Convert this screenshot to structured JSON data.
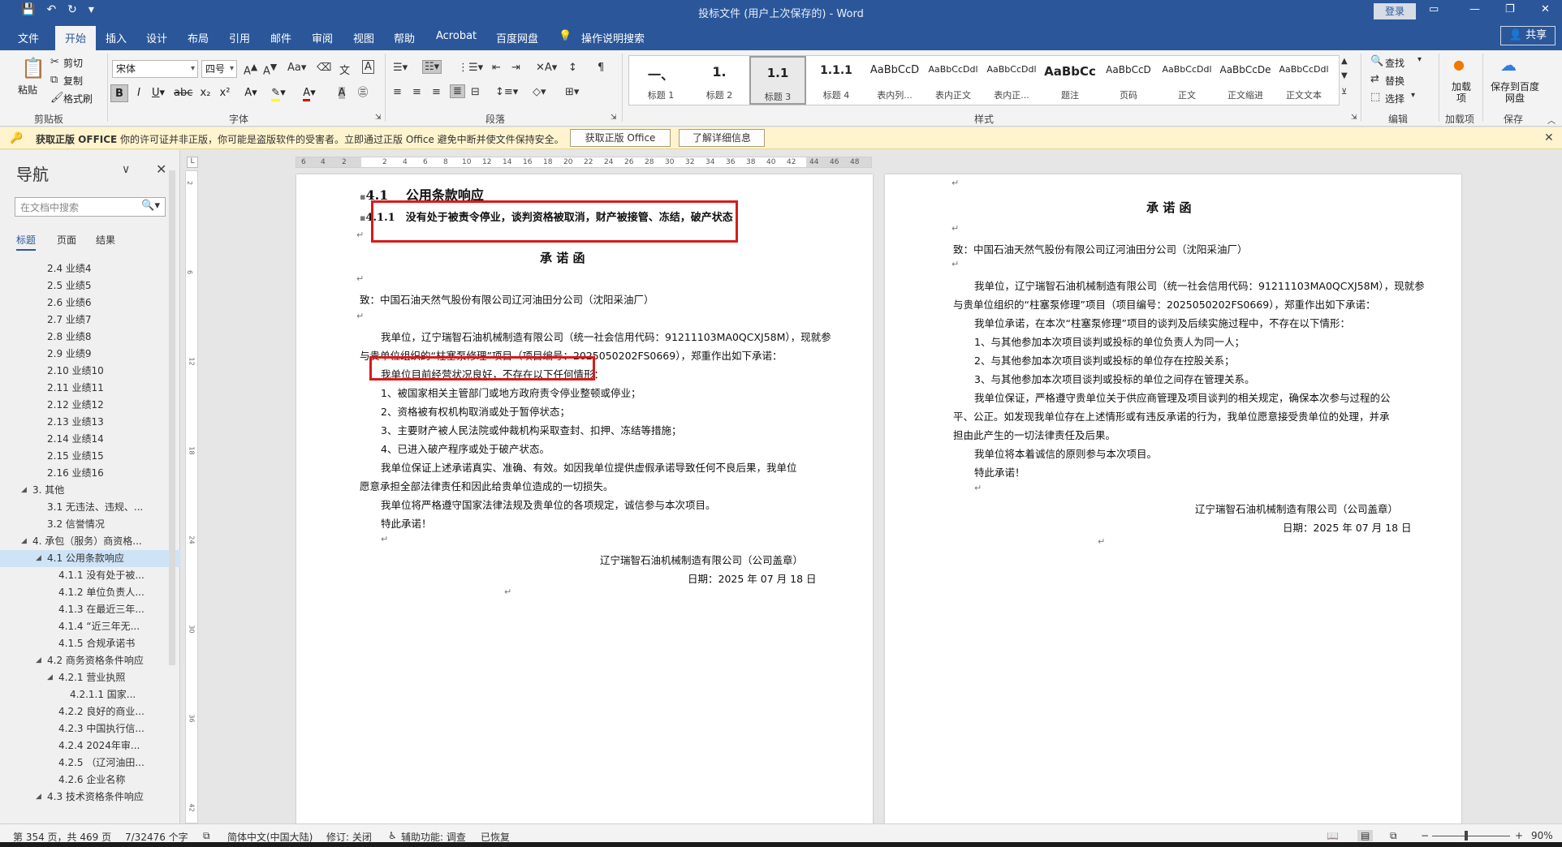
{
  "window": {
    "title": "投标文件 (用户上次保存的) - Word",
    "login_label": "登录",
    "qat": [
      "save-icon",
      "undo-icon",
      "redo-icon",
      "customize-icon"
    ]
  },
  "tabs": [
    "文件",
    "开始",
    "插入",
    "设计",
    "布局",
    "引用",
    "邮件",
    "审阅",
    "视图",
    "帮助",
    "Acrobat",
    "百度网盘",
    "操作说明搜索"
  ],
  "active_tab": "开始",
  "share_label": "共享",
  "ribbon": {
    "clipboard": {
      "paste": "粘贴",
      "cut": "剪切",
      "copy": "复制",
      "format_painter": "格式刷",
      "label": "剪贴板"
    },
    "font": {
      "font_name": "宋体",
      "font_size": "四号",
      "label": "字体"
    },
    "paragraph": {
      "label": "段落"
    },
    "styles": {
      "label": "样式",
      "items": [
        {
          "preview": "一、",
          "name": "标题 1"
        },
        {
          "preview": "1.",
          "name": "标题 2"
        },
        {
          "preview": "1.1",
          "name": "标题 3"
        },
        {
          "preview": "1.1.1",
          "name": "标题 4"
        },
        {
          "preview": "AaBbCcD",
          "name": "表内列..."
        },
        {
          "preview": "AaBbCcDdl",
          "name": "表内正文"
        },
        {
          "preview": "AaBbCcDdl",
          "name": "表内正..."
        },
        {
          "preview": "AaBbCc",
          "name": "题注"
        },
        {
          "preview": "AaBbCcD",
          "name": "页码"
        },
        {
          "preview": "AaBbCcDdl",
          "name": "正文"
        },
        {
          "preview": "AaBbCcDe",
          "name": "正文缩进"
        },
        {
          "preview": "AaBbCcDdl",
          "name": "正文文本"
        }
      ],
      "selected_index": 2
    },
    "editing": {
      "find": "查找",
      "replace": "替换",
      "select": "选择",
      "label": "编辑"
    },
    "addins": {
      "btn": "加载项",
      "label": "加载项"
    },
    "save": {
      "btn": "保存到百度网盘",
      "label": "保存"
    }
  },
  "infobar": {
    "title": "获取正版 OFFICE",
    "message": "你的许可证并非正版，你可能是盗版软件的受害者。立即通过正版 Office 避免中断并使文件保持安全。",
    "btn1": "获取正版 Office",
    "btn2": "了解详细信息"
  },
  "nav": {
    "title": "导航",
    "search_placeholder": "在文档中搜索",
    "tabs": [
      "标题",
      "页面",
      "结果"
    ],
    "items": [
      {
        "text": "2.4 业绩4",
        "level": 3
      },
      {
        "text": "2.5 业绩5",
        "level": 3
      },
      {
        "text": "2.6 业绩6",
        "level": 3
      },
      {
        "text": "2.7 业绩7",
        "level": 3
      },
      {
        "text": "2.8 业绩8",
        "level": 3
      },
      {
        "text": "2.9 业绩9",
        "level": 3
      },
      {
        "text": "2.10 业绩10",
        "level": 3
      },
      {
        "text": "2.11 业绩11",
        "level": 3
      },
      {
        "text": "2.12 业绩12",
        "level": 3
      },
      {
        "text": "2.13 业绩13",
        "level": 3
      },
      {
        "text": "2.14 业绩14",
        "level": 3
      },
      {
        "text": "2.15 业绩15",
        "level": 3
      },
      {
        "text": "2.16 业绩16",
        "level": 3
      },
      {
        "text": "3. 其他",
        "level": 2,
        "caret": true
      },
      {
        "text": "3.1 无违法、违规、...",
        "level": 3
      },
      {
        "text": "3.2 信誉情况",
        "level": 3
      },
      {
        "text": "4. 承包（服务）商资格...",
        "level": 2,
        "caret": true
      },
      {
        "text": "4.1 公用条款响应",
        "level": 3,
        "caret": true,
        "selected": true
      },
      {
        "text": "4.1.1 没有处于被...",
        "level": 4
      },
      {
        "text": "4.1.2 单位负责人...",
        "level": 4
      },
      {
        "text": "4.1.3 在最近三年...",
        "level": 4
      },
      {
        "text": "4.1.4 “近三年无...",
        "level": 4
      },
      {
        "text": "4.1.5 合规承诺书",
        "level": 4
      },
      {
        "text": "4.2 商务资格条件响应",
        "level": 3,
        "caret": true
      },
      {
        "text": "4.2.1 营业执照",
        "level": 4,
        "caret": true
      },
      {
        "text": "4.2.1.1 国家...",
        "level": 5
      },
      {
        "text": "4.2.2 良好的商业...",
        "level": 4
      },
      {
        "text": "4.2.3 中国执行信...",
        "level": 4
      },
      {
        "text": "4.2.4 2024年审...",
        "level": 4
      },
      {
        "text": "4.2.5 （辽河油田...",
        "level": 4
      },
      {
        "text": "4.2.6 企业名称",
        "level": 4
      },
      {
        "text": "4.3 技术资格条件响应",
        "level": 3,
        "caret": true
      }
    ]
  },
  "page1": {
    "h1": "4.1　 公用条款响应",
    "h2_num": "4.1.1",
    "h2": "没有处于被责令停业，谈判资格被取消，财产被接管、冻结，破产状态",
    "letter_title": "承 诺 函",
    "to": "致：中国石油天然气股份有限公司辽河油田分公司（沈阳采油厂）",
    "p1a": "我单位，辽宁瑞智石油机械制造有限公司（统一社会信用代码：91211103MA0QCXJ58M），现就参",
    "p1b": "与贵单位组织的“柱塞泵修理”项目（项目编号：2025050202FS0669），郑重作出如下承诺：",
    "boxed": "我单位目前经营状况良好，不存在以下任何情形：",
    "list": [
      "1、被国家相关主管部门或地方政府责令停业整顿或停业；",
      "2、资格被有权机构取消或处于暂停状态；",
      "3、主要财产被人民法院或仲裁机构采取查封、扣押、冻结等措施；",
      "4、已进入破产程序或处于破产状态。"
    ],
    "p2a": "我单位保证上述承诺真实、准确、有效。如因我单位提供虚假承诺导致任何不良后果，我单位",
    "p2b": "愿意承担全部法律责任和因此给贵单位造成的一切损失。",
    "p3": "我单位将严格遵守国家法律法规及贵单位的各项规定，诚信参与本次项目。",
    "closing": "特此承诺！",
    "company": "辽宁瑞智石油机械制造有限公司（公司盖章）",
    "date": "日期：2025 年 07 月 18 日"
  },
  "page2": {
    "letter_title": "承 诺 函",
    "to": "致：中国石油天然气股份有限公司辽河油田分公司（沈阳采油厂）",
    "p1a": "我单位，辽宁瑞智石油机械制造有限公司（统一社会信用代码：91211103MA0QCXJ58M），现就参",
    "p1b": "与贵单位组织的“柱塞泵修理”项目（项目编号：2025050202FS0669），郑重作出如下承诺：",
    "p2": "我单位承诺，在本次“柱塞泵修理”项目的谈判及后续实施过程中，不存在以下情形：",
    "list": [
      "1、与其他参加本次项目谈判或投标的单位负责人为同一人；",
      "2、与其他参加本次项目谈判或投标的单位存在控股关系；",
      "3、与其他参加本次项目谈判或投标的单位之间存在管理关系。"
    ],
    "p3a": "我单位保证，严格遵守贵单位关于供应商管理及项目谈判的相关规定，确保本次参与过程的公",
    "p3b": "平、公正。如发现我单位存在上述情形或有违反承诺的行为，我单位愿意接受贵单位的处理，并承",
    "p3c": "担由此产生的一切法律责任及后果。",
    "p4": "我单位将本着诚信的原则参与本次项目。",
    "closing": "特此承诺！",
    "company": "辽宁瑞智石油机械制造有限公司（公司盖章）",
    "date": "日期：2025 年 07 月 18 日"
  },
  "status": {
    "page": "第 354 页，共 469 页",
    "words": "7/32476 个字",
    "lang": "简体中文(中国大陆)",
    "track": "修订: 关闭",
    "accessibility": "辅助功能: 调查",
    "recovered": "已恢复",
    "zoom": "90%"
  }
}
